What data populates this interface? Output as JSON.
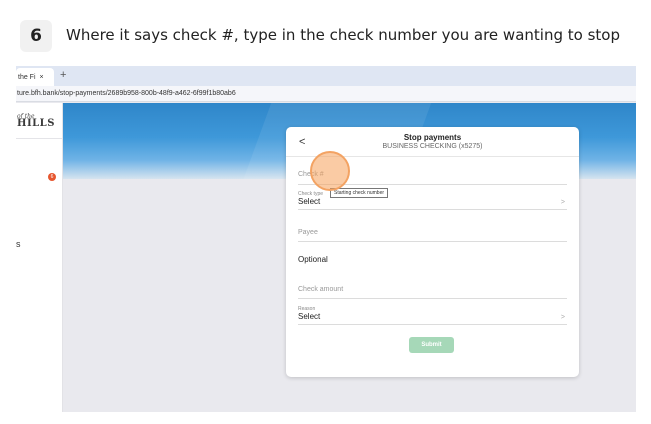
{
  "step": {
    "number": "6",
    "instruction": "Where it says check #, type in the check number you are wanting to stop"
  },
  "browser": {
    "tab_label": "the Fi",
    "tab_close": "×",
    "new_tab": "+",
    "url": "ture.bfh.bank/stop-payments/2689b958-800b-48f9-a462-6f99f1b80ab6"
  },
  "sidebar": {
    "brand_small": "of the",
    "brand_big": "HILLS",
    "notification_count": "6",
    "item_partial": "s"
  },
  "card": {
    "back": "<",
    "title": "Stop payments",
    "subtitle": "BUSINESS CHECKING (x5275)",
    "check_number_placeholder": "Check #",
    "check_type_label": "Check type",
    "check_type_value": "Select",
    "tooltip": "Starting check number",
    "payee_placeholder": "Payee",
    "optional_label": "Optional",
    "check_amount_placeholder": "Check amount",
    "reason_label": "Reason",
    "reason_value": "Select",
    "submit_label": "Submit",
    "chevron": ">"
  },
  "colors": {
    "accent_highlight": "#f3a363",
    "submit_disabled": "#a6d8b8",
    "hero_blue": "#2f86c9",
    "notification": "#e6562f"
  }
}
